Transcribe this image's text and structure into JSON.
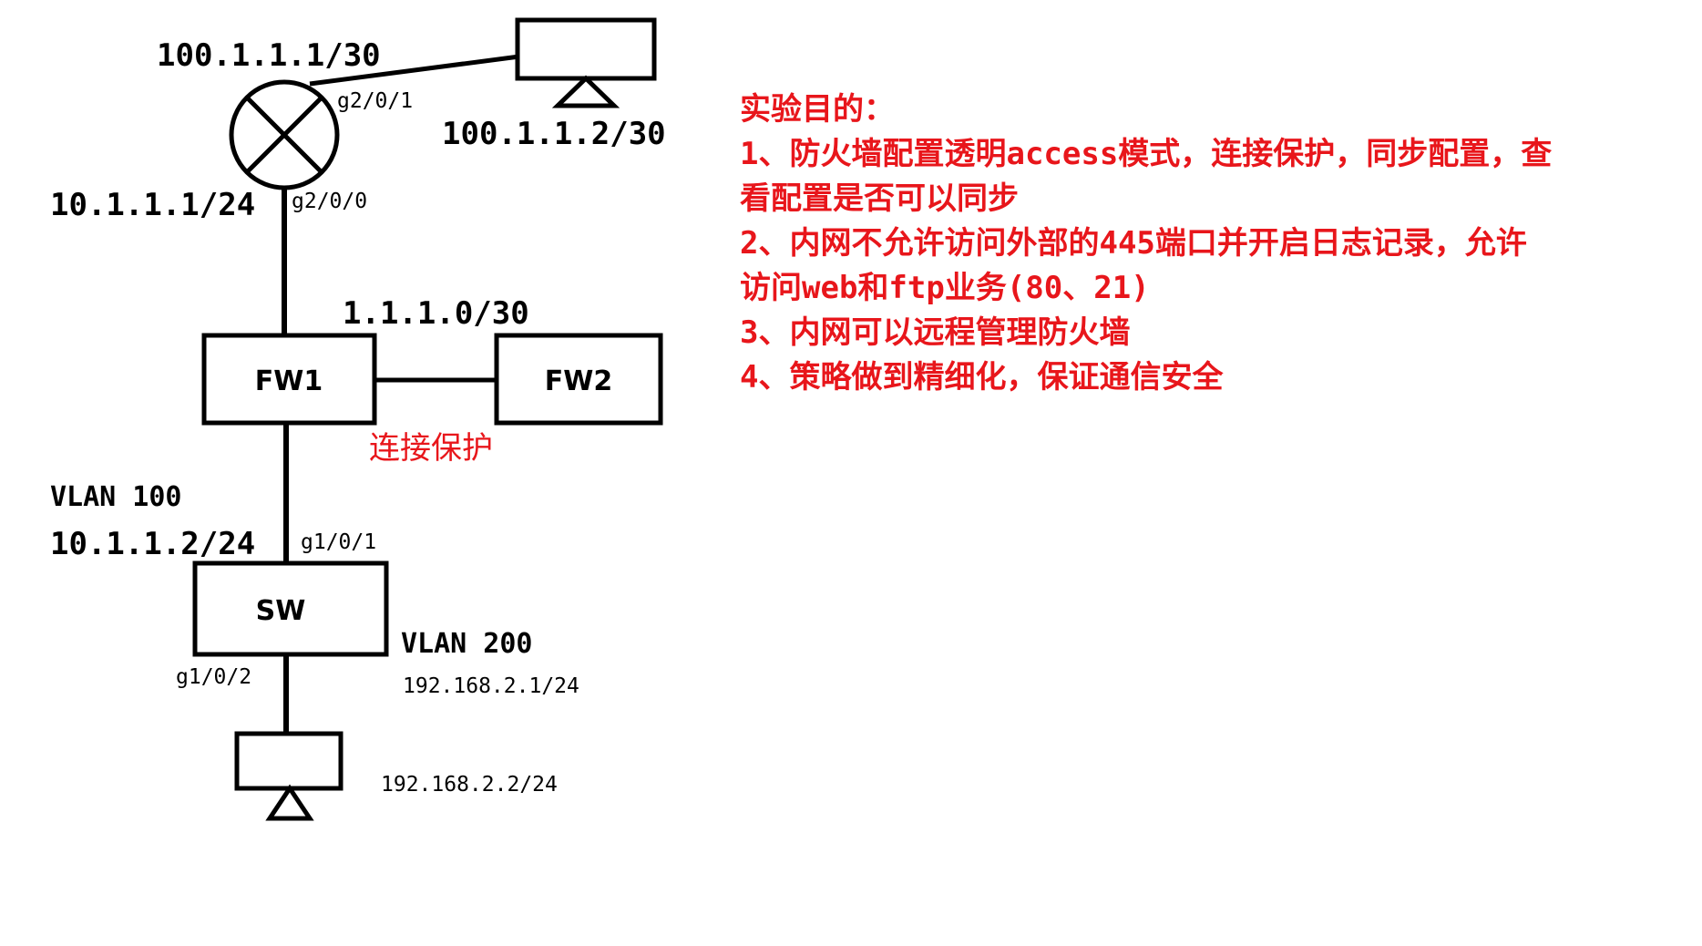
{
  "colors": {
    "lines": "#000000",
    "accent_text": "#e8161b",
    "background": "#ffffff"
  },
  "devices": {
    "router": {
      "icon": "router-icon"
    },
    "fw1": {
      "label": "FW1"
    },
    "fw2": {
      "label": "FW2"
    },
    "sw": {
      "label": "SW"
    },
    "internet_pc": {
      "icon": "pc-icon"
    },
    "lan_pc": {
      "icon": "pc-icon"
    }
  },
  "labels": {
    "router_wan_ip": "100.1.1.1/30",
    "router_wan_port": "g2/0/1",
    "internet_pc_ip": "100.1.1.2/30",
    "router_lan_ip": "10.1.1.1/24",
    "router_lan_port": "g2/0/0",
    "ha_link_net": "1.1.1.0/30",
    "ha_link_note": "连接保护",
    "vlan100": "VLAN 100",
    "sw_uplink_ip": "10.1.1.2/24",
    "sw_uplink_port": "g1/0/1",
    "vlan200": "VLAN 200",
    "sw_vlanif200_ip": "192.168.2.1/24",
    "sw_access_port": "g1/0/2",
    "lan_pc_ip": "192.168.2.2/24"
  },
  "objectives": {
    "lines": [
      "实验目的：",
      "1、防火墙配置透明access模式，连接保护，同步配置，查",
      "看配置是否可以同步",
      "2、内网不允许访问外部的445端口并开启日志记录，允许",
      "访问web和ftp业务(80、21)",
      "3、内网可以远程管理防火墙",
      "4、策略做到精细化，保证通信安全"
    ]
  }
}
